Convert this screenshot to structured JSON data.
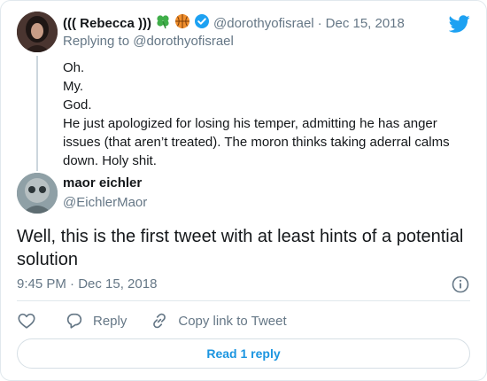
{
  "parent": {
    "display_name": "((( Rebecca )))",
    "emojis": [
      "four-leaf-clover-icon",
      "basketball-icon"
    ],
    "verified": true,
    "handle": "@dorothyofisrael",
    "separator": "·",
    "date": "Dec 15, 2018",
    "replying_to_prefix": "Replying to",
    "replying_to_handle": "@dorothyofisrael",
    "lines": [
      "Oh.",
      "My.",
      "God.",
      "He just apologized for losing his temper, admitting he has anger issues (that aren’t treated). The moron thinks taking aderral calms down. Holy shit."
    ]
  },
  "tweet": {
    "display_name": "maor eichler",
    "handle": "@EichlerMaor",
    "text": "Well, this is the first tweet with at least hints of a potential solution",
    "timestamp": "9:45 PM · Dec 15, 2018"
  },
  "actions": {
    "reply_label": "Reply",
    "copy_label": "Copy link to Tweet"
  },
  "read_reply_label": "Read 1 reply",
  "colors": {
    "accent": "#1b95e0",
    "twitter_blue": "#1da1f2",
    "muted": "#657786",
    "text": "#14171a",
    "border": "#e1e8ed"
  }
}
